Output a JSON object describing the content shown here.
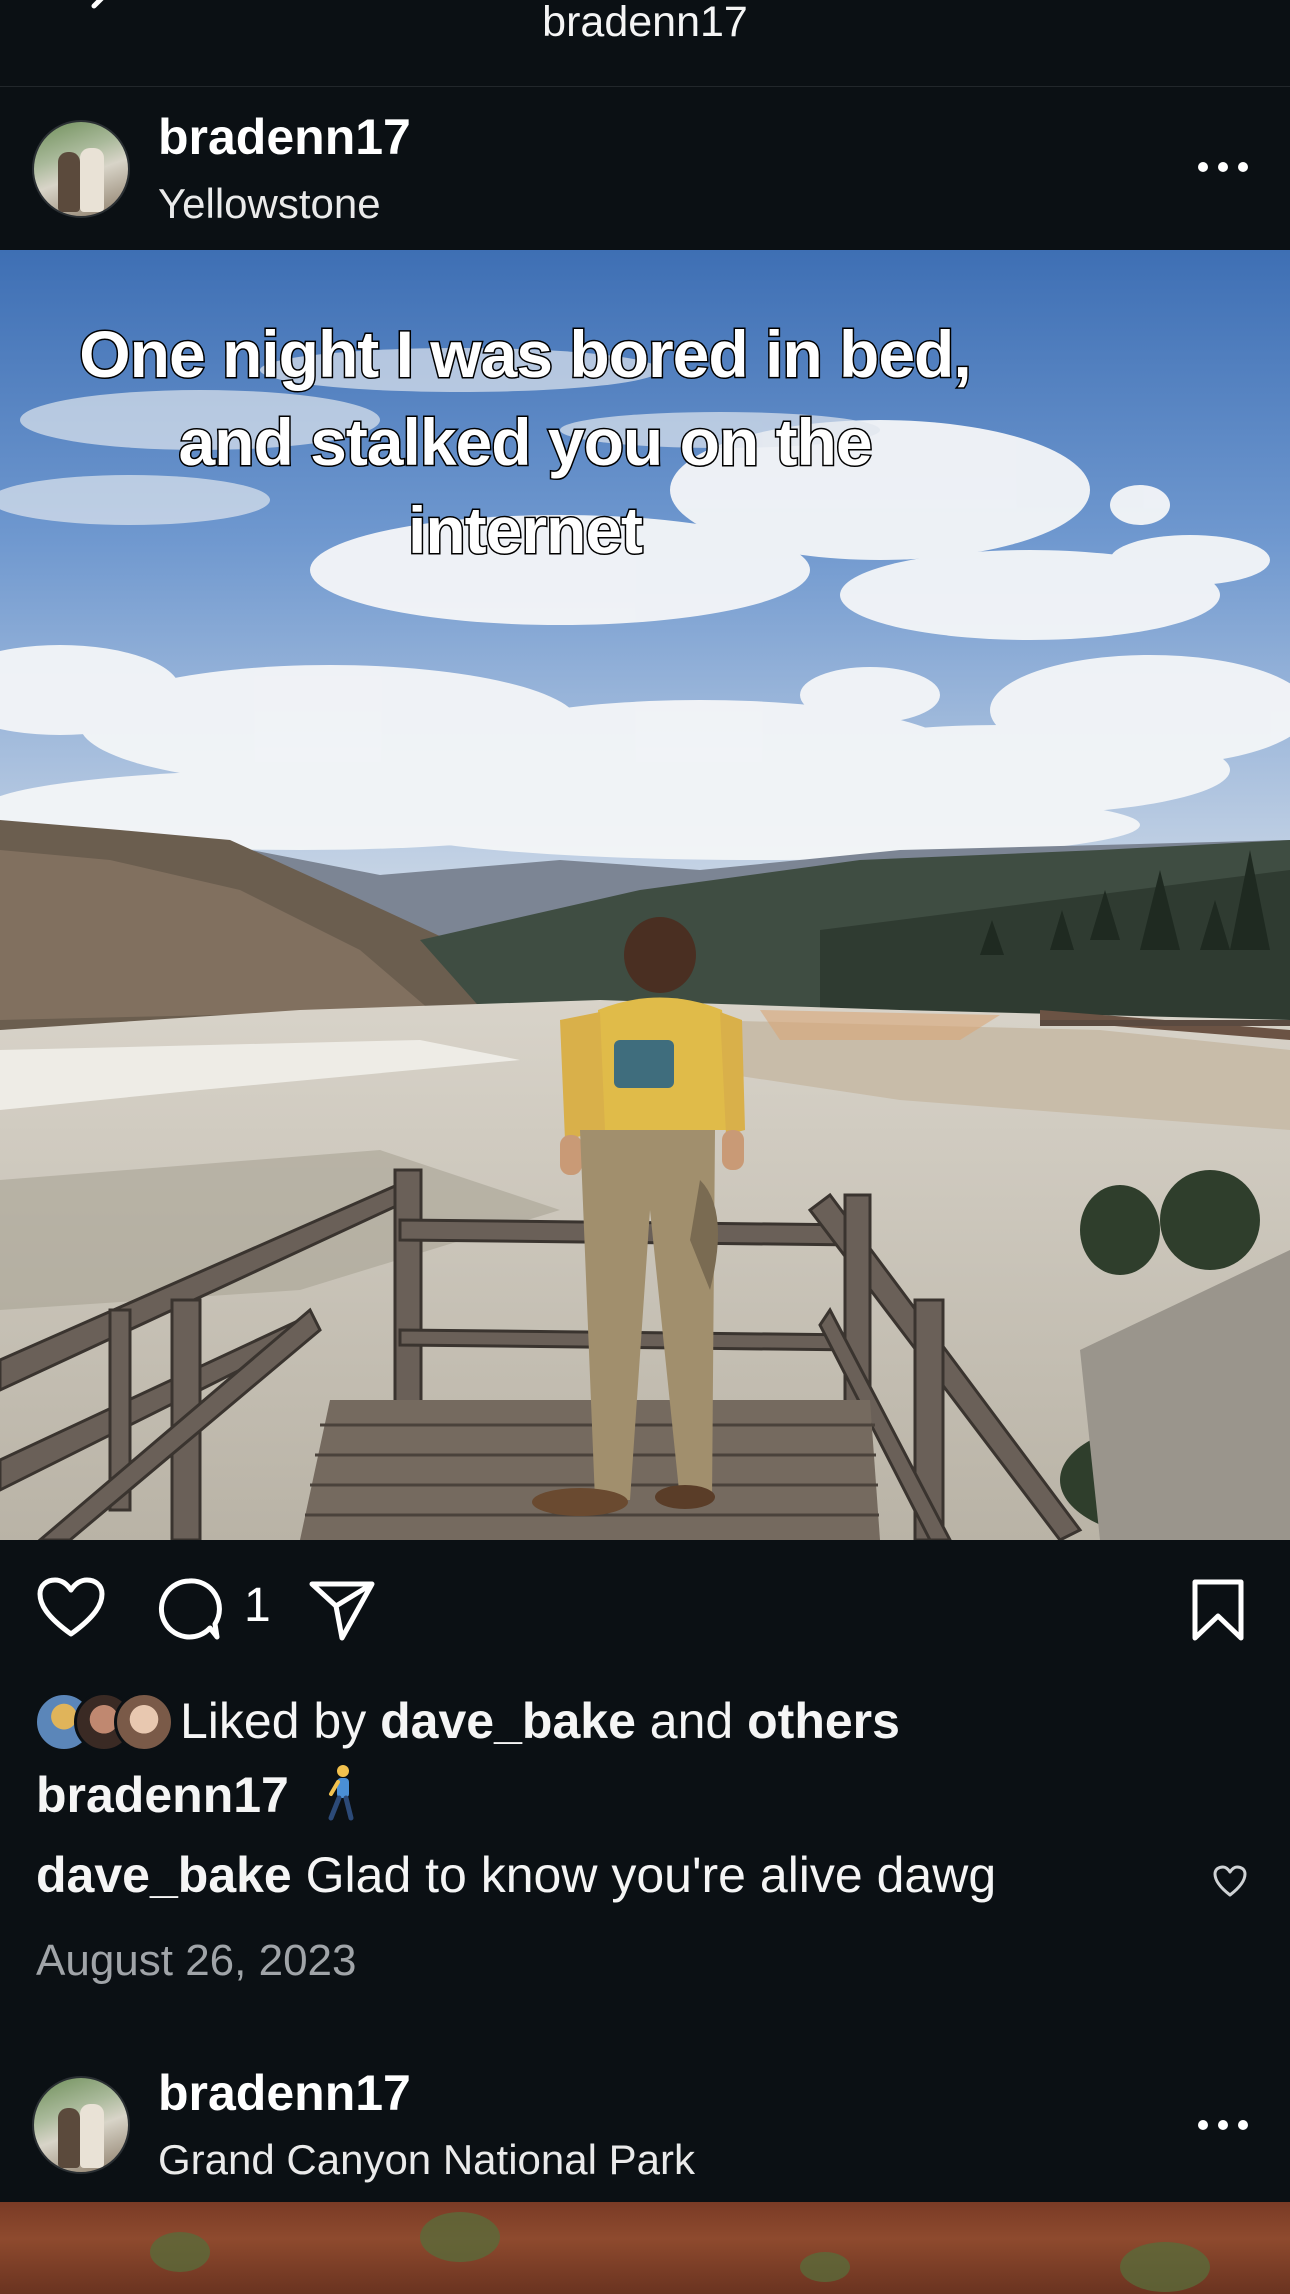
{
  "header": {
    "title": "bradenn17",
    "back_icon": "chevron-left-icon"
  },
  "posts": [
    {
      "username": "bradenn17",
      "location": "Yellowstone",
      "overlay_text": [
        "One night I was bored in bed,",
        "and stalked you on the",
        "internet"
      ],
      "comment_count": "1",
      "liked_by_prefix": "Liked by",
      "liked_by_user": "dave_bake",
      "liked_by_and": "and",
      "liked_by_others": "others",
      "caption_user": "bradenn17",
      "caption_emoji": "person-walking",
      "comment": {
        "user": "dave_bake",
        "text": "Glad to know you're alive dawg"
      },
      "date": "August 26, 2023"
    },
    {
      "username": "bradenn17",
      "location": "Grand Canyon National Park"
    }
  ],
  "icons": [
    "chevron-left-icon",
    "more-icon",
    "heart-icon",
    "comment-icon",
    "share-icon",
    "bookmark-icon",
    "small-heart-icon"
  ],
  "colors": {
    "background": "#0b1014",
    "text": "#f5f5f5",
    "muted": "#a0a4a8"
  }
}
